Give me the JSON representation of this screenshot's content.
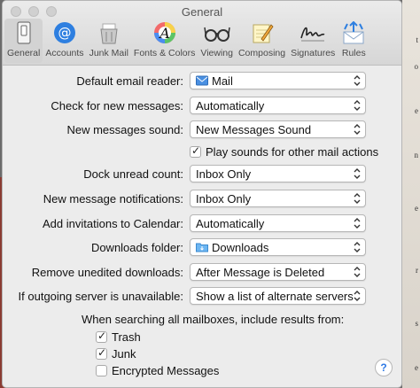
{
  "window": {
    "title": "General"
  },
  "toolbar": {
    "tabs": [
      {
        "label": "General",
        "icon": "switch-icon",
        "active": true
      },
      {
        "label": "Accounts",
        "icon": "at-sign-icon"
      },
      {
        "label": "Junk Mail",
        "icon": "junk-trash-icon"
      },
      {
        "label": "Fonts & Colors",
        "icon": "fonts-colors-icon"
      },
      {
        "label": "Viewing",
        "icon": "glasses-icon"
      },
      {
        "label": "Composing",
        "icon": "pencil-paper-icon"
      },
      {
        "label": "Signatures",
        "icon": "signature-icon"
      },
      {
        "label": "Rules",
        "icon": "rules-envelope-icon"
      }
    ]
  },
  "settings": {
    "default_email_reader": {
      "label": "Default email reader:",
      "value": "Mail",
      "icon": "mail-app-icon"
    },
    "check_new_messages": {
      "label": "Check for new messages:",
      "value": "Automatically"
    },
    "new_messages_sound": {
      "label": "New messages sound:",
      "value": "New Messages Sound"
    },
    "play_sounds": {
      "label": "Play sounds for other mail actions",
      "checked": true
    },
    "dock_unread_count": {
      "label": "Dock unread count:",
      "value": "Inbox Only"
    },
    "new_message_notifications": {
      "label": "New message notifications:",
      "value": "Inbox Only"
    },
    "add_invitations": {
      "label": "Add invitations to Calendar:",
      "value": "Automatically"
    },
    "downloads_folder": {
      "label": "Downloads folder:",
      "value": "Downloads",
      "icon": "folder-icon"
    },
    "remove_unedited": {
      "label": "Remove unedited downloads:",
      "value": "After Message is Deleted"
    },
    "outgoing_server": {
      "label": "If outgoing server is unavailable:",
      "value": "Show a list of alternate servers"
    }
  },
  "search": {
    "label": "When searching all mailboxes, include results from:",
    "trash": {
      "label": "Trash",
      "checked": true
    },
    "junk": {
      "label": "Junk",
      "checked": true
    },
    "encrypted": {
      "label": "Encrypted Messages",
      "checked": false
    }
  },
  "help": {
    "label": "?"
  },
  "colors": {
    "window_bg": "#ececec",
    "accent": "#2f7ae5"
  }
}
